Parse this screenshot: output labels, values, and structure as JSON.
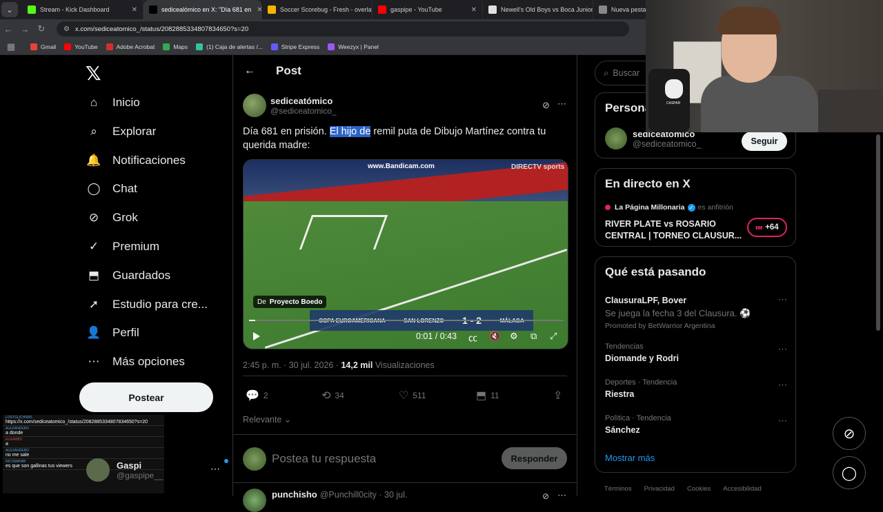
{
  "browser": {
    "tabs": [
      {
        "title": "Stream - Kick Dashboard",
        "fav_color": "#53fc18"
      },
      {
        "title": "sedicealómico en X: \"Día 681 en",
        "fav_color": "#000000"
      },
      {
        "title": "Soccer Scorebug - Fresh - overlay",
        "fav_color": "#f4b400"
      },
      {
        "title": "gaspipe - YouTube",
        "fav_color": "#ff0000"
      },
      {
        "title": "Newell's Old Boys vs Boca Juniors",
        "fav_color": "#e0e0e0"
      },
      {
        "title": "Nueva pestaña",
        "fav_color": "#888888"
      }
    ],
    "url": "x.com/sediceatomico_/status/2082885334807834650?s=20",
    "bookmarks": [
      {
        "label": "Gmail",
        "color": "#ea4335"
      },
      {
        "label": "YouTube",
        "color": "#ff0000"
      },
      {
        "label": "Adobe Acrobat",
        "color": "#d32f2f"
      },
      {
        "label": "Maps",
        "color": "#34a853"
      },
      {
        "label": "(1) Caja de alertas /...",
        "color": "#32c3a2"
      },
      {
        "label": "Stripe Express",
        "color": "#635bff"
      },
      {
        "label": "Weezyx | Panel",
        "color": "#9b59f6"
      }
    ]
  },
  "nav": {
    "logo": "𝕏",
    "items": [
      {
        "label": "Inicio",
        "icon": "home-icon",
        "glyph": "⌂"
      },
      {
        "label": "Explorar",
        "icon": "search-icon",
        "glyph": "⌕"
      },
      {
        "label": "Notificaciones",
        "icon": "bell-icon",
        "glyph": "🔔"
      },
      {
        "label": "Chat",
        "icon": "chat-icon",
        "glyph": "◯"
      },
      {
        "label": "Grok",
        "icon": "grok-icon",
        "glyph": "⊘"
      },
      {
        "label": "Premium",
        "icon": "premium-icon",
        "glyph": "✓"
      },
      {
        "label": "Guardados",
        "icon": "bookmark-icon",
        "glyph": "⬒"
      },
      {
        "label": "Estudio para cre...",
        "icon": "rocket-icon",
        "glyph": "➚"
      },
      {
        "label": "Perfil",
        "icon": "profile-icon",
        "glyph": "👤"
      },
      {
        "label": "Más opciones",
        "icon": "more-icon",
        "glyph": "⋯"
      }
    ],
    "post_button": "Postear",
    "account": {
      "name": "Gaspi",
      "handle": "@gaspipe__",
      "more": "⋯"
    }
  },
  "stream_chat": [
    {
      "user": "LOSTGLICH0MS",
      "msg": "https://x.com/sediceatomico_/status/2082885334807834650?s=20",
      "red": false
    },
    {
      "user": "ALEXANDERO",
      "msg": "a donde",
      "red": false
    },
    {
      "user": "ELRAMBO",
      "msg": "a",
      "red": true
    },
    {
      "user": "ALEXANDERO",
      "msg": "no me sale",
      "red": false
    },
    {
      "user": "NICOMAN88",
      "msg": "es que son gallinas tus viewers",
      "red": false
    }
  ],
  "main": {
    "header_title": "Post",
    "post": {
      "name": "sediceatómico",
      "handle": "@sediceatomico_",
      "text_before": "Día 681 en prisión. ",
      "text_highlight": "El hijo de",
      "text_after": " remil puta de Dibujo Martínez contra tu querida madre:",
      "video": {
        "watermark": "www.Bandicam.com",
        "brand": "DIRECTV sports",
        "source_prefix": "De",
        "source_name": "Proyecto Boedo",
        "score_home": "SAN LORENZO",
        "score": "1 - 2",
        "score_away": "MÁLAGA",
        "competition": "COPA EUROAMERICANA",
        "time": "0:01 / 0:43",
        "progress": 0.02
      },
      "timestamp": "2:45 p. m. · 30 jul. 2026 ·",
      "views": "14,2 mil",
      "views_label": "Visualizaciones",
      "replies": "2",
      "reposts": "34",
      "likes": "511",
      "bookmarks": "11"
    },
    "sort_label": "Relevante",
    "reply_placeholder": "Postea tu respuesta",
    "reply_button": "Responder",
    "comment": {
      "name": "punchisho",
      "handle": "@Punchill0city · 30 jul."
    }
  },
  "right": {
    "search_placeholder": "Buscar",
    "people_title": "Personas relevantes",
    "person": {
      "name": "sediceatómico",
      "handle": "@sediceatomico_",
      "follow": "Seguir"
    },
    "live_title": "En directo en X",
    "live": {
      "host": "La Página Millonaria",
      "host_suffix": "es anfitrión",
      "event": "RIVER PLATE vs ROSARIO CENTRAL | TORNEO CLAUSUR...",
      "count": "+64"
    },
    "trends_title": "Qué está pasando",
    "trends": [
      {
        "category": "",
        "title": "ClausuraLPF, Bover",
        "desc": "Se juega la fecha 3 del Clausura. ⚽",
        "promo": "Promoted by BetWarrior Argentina"
      },
      {
        "category": "Tendencias",
        "title": "Diomande y Rodri",
        "desc": "",
        "promo": ""
      },
      {
        "category": "Deportes · Tendencia",
        "title": "Riestra",
        "desc": "",
        "promo": ""
      },
      {
        "category": "Política · Tendencia",
        "title": "Sánchez",
        "desc": "",
        "promo": ""
      }
    ],
    "show_more": "Mostrar más",
    "footer": [
      "Términos",
      "Privacidad",
      "Cookies",
      "Accesibilidad"
    ]
  },
  "webcam": {
    "badge_text": "CASPAR"
  }
}
